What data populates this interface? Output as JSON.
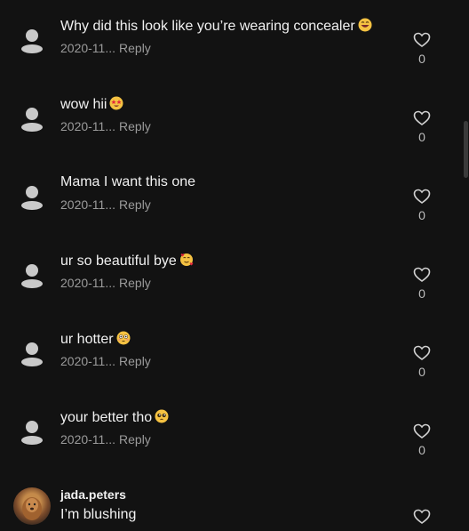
{
  "comments": [
    {
      "text": "Why did this look like you’re wearing concealer",
      "emoji": "laugh",
      "date": "2020-11...",
      "reply": "Reply",
      "likes": "0"
    },
    {
      "text": "wow hii",
      "emoji": "star-eyes",
      "date": "2020-11...",
      "reply": "Reply",
      "likes": "0"
    },
    {
      "text": "Mama I want this one",
      "emoji": "",
      "date": "2020-11...",
      "reply": "Reply",
      "likes": "0"
    },
    {
      "text": "ur so beautiful bye",
      "emoji": "hearts",
      "date": "2020-11...",
      "reply": "Reply",
      "likes": "0"
    },
    {
      "text": "ur hotter",
      "emoji": "flushed",
      "date": "2020-11...",
      "reply": "Reply",
      "likes": "0"
    },
    {
      "text": "your better tho",
      "emoji": "pleading",
      "date": "2020-11...",
      "reply": "Reply",
      "likes": "0"
    }
  ],
  "last_comment": {
    "username": "jada.peters",
    "text": "I’m blushing"
  },
  "colors": {
    "background": "#121212",
    "text": "#f1f1f1",
    "muted": "#9b9b9b",
    "emoji": "#f5c242"
  }
}
